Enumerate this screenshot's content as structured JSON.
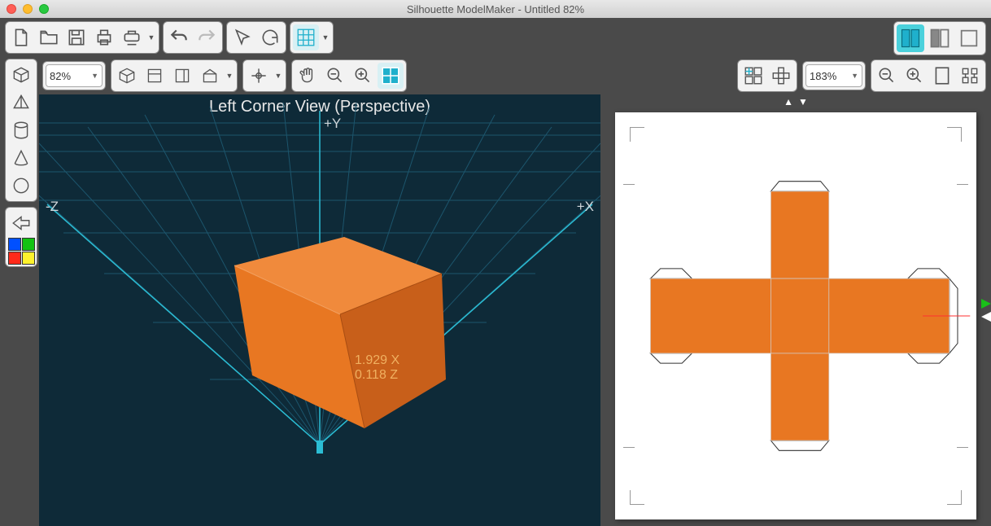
{
  "app": {
    "title": "Silhouette ModelMaker - Untitled 82%"
  },
  "zoom3d": "82%",
  "zoom2d": "183%",
  "view3d": {
    "label": "Left Corner View (Perspective)",
    "axis_py": "+Y",
    "axis_nz": "-Z",
    "axis_px": "+X",
    "readout_line1": "1.929 X",
    "readout_line2": "0.118 Z"
  },
  "colors": {
    "shape": "#e87722",
    "shape_dark": "#c35f15",
    "grid": "#1e5a72",
    "bg3d": "#0e2a38"
  }
}
